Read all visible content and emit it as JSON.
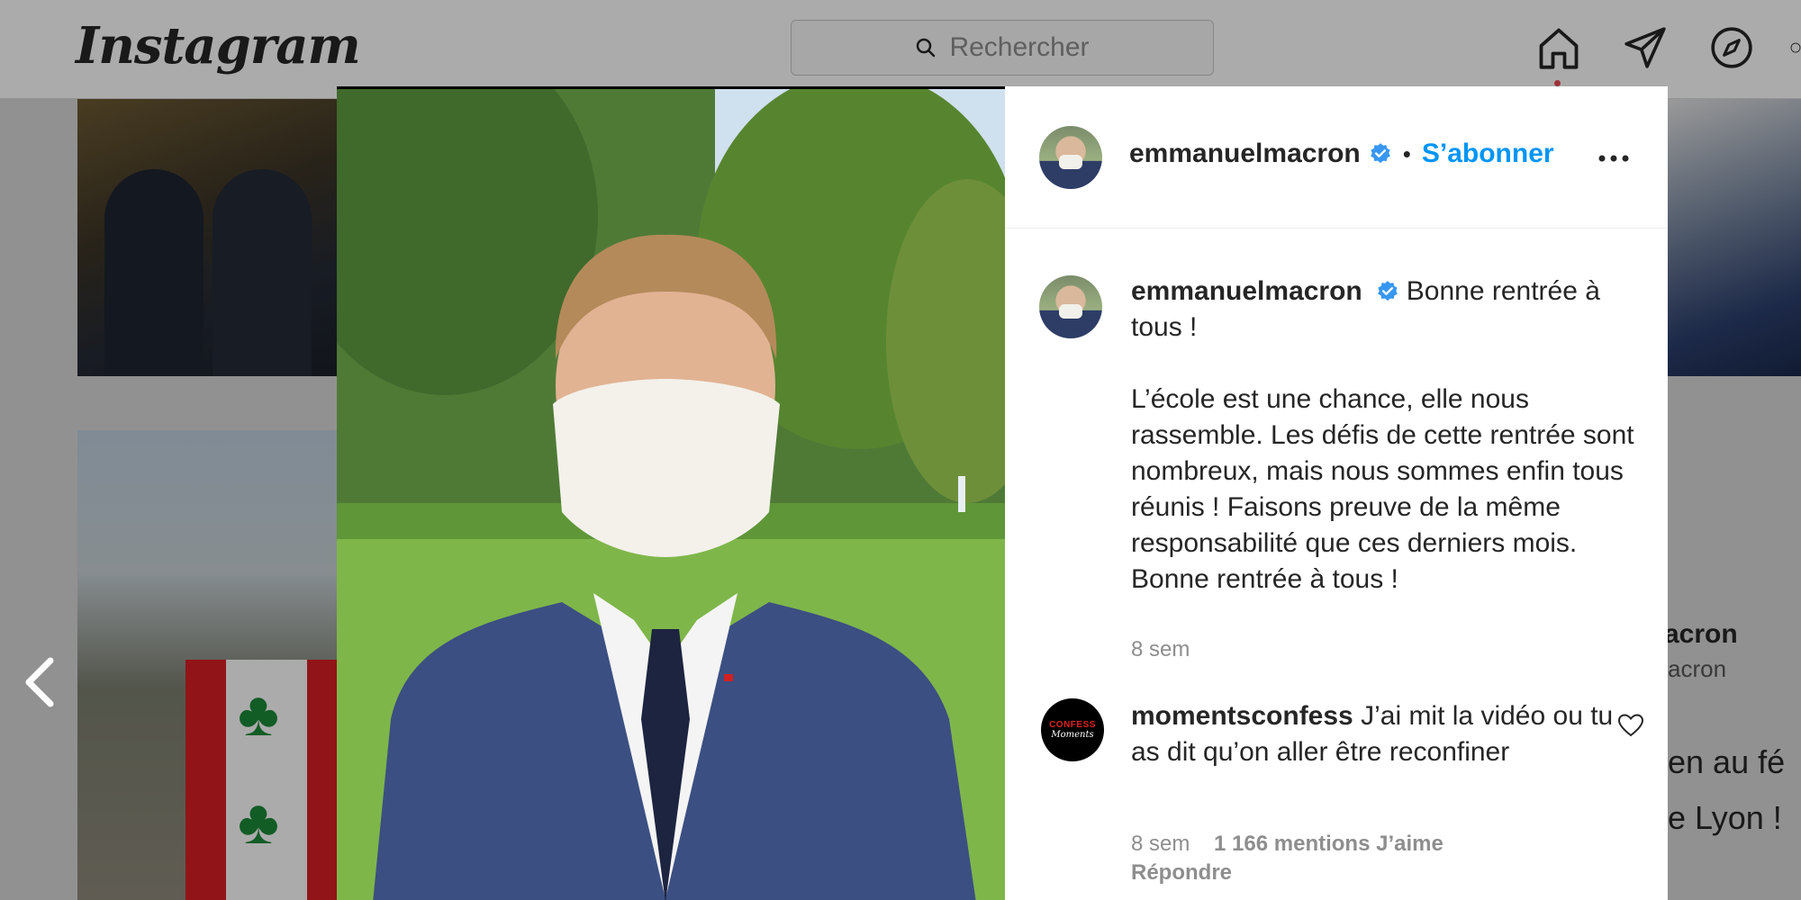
{
  "app": {
    "logo": "Instagram",
    "search_placeholder": "Rechercher"
  },
  "colors": {
    "link_blue": "#0095f6",
    "verified_blue": "#3897f0",
    "notification_red": "#ed4956"
  },
  "nav": {
    "icons": [
      "home-icon",
      "direct-message-icon",
      "explore-icon"
    ]
  },
  "background": {
    "right_post_username_partial": "acron",
    "right_post_subtitle_partial": "acron",
    "right_post_text_1": "en au fé",
    "right_post_text_2": "e Lyon !"
  },
  "post": {
    "author": "emmanuelmacron",
    "follow_label": "S’abonner",
    "caption_first": "Bonne rentrée à tous !",
    "caption_body": "L’école est une chance, elle nous rassemble. Les défis de cette rentrée sont nombreux, mais nous sommes enfin tous réunis ! Faisons preuve de la même responsabilité que ces derniers mois. Bonne rentrée à tous !",
    "caption_time": "8 sem"
  },
  "comments": [
    {
      "author": "momentsconfess",
      "avatar_text_1": "CONFESS",
      "avatar_text_2": "Moments",
      "text": "J’ai mit la vidéo ou tu as dit qu’on aller être reconfiner",
      "time": "8 sem",
      "likes": "1 166 mentions J’aime",
      "reply_label": "Répondre"
    }
  ]
}
